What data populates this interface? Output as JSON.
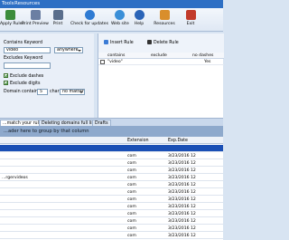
{
  "menu": {
    "items": [
      "Tools",
      "Resources"
    ]
  },
  "toolbar": {
    "buttons": [
      {
        "label": "Apply Rules",
        "icon": "apply-rules-icon",
        "color": "#3c8d3c"
      },
      {
        "label": "Print Preview",
        "icon": "print-preview-icon",
        "color": "#6b7fa3"
      },
      {
        "label": "Print",
        "icon": "printer-icon",
        "color": "#5a6e8c"
      },
      {
        "label": "Check for updates",
        "icon": "update-icon",
        "color": "#2f7bd3"
      },
      {
        "label": "Web site",
        "icon": "globe-icon",
        "color": "#3a8fd8"
      },
      {
        "label": "Help",
        "icon": "help-icon",
        "color": "#2a64b8"
      },
      {
        "label": "Resources",
        "icon": "resources-icon",
        "color": "#d98e2b"
      },
      {
        "label": "Exit",
        "icon": "exit-icon",
        "color": "#c23b2b"
      }
    ]
  },
  "left": {
    "contains_label": "Contains Keyword",
    "contains_value": "video",
    "match_value": "anywhere",
    "excludes_label": "Excludes Keyword",
    "excludes_value": "",
    "exclude_dashes": "Exclude dashes",
    "exclude_digits": "Exclude digits",
    "domain_contains_label": "Domain contains",
    "domain_contains_value": "5",
    "char_label": "char",
    "no_matter_value": "no matter"
  },
  "right": {
    "insert_rule": "Insert Rule",
    "delete_rule": "Delete Rule",
    "headers": [
      "contains",
      "exclude",
      "no dashes"
    ],
    "rows": [
      {
        "contains": "\"video\"",
        "exclude": "",
        "no_dashes": "Yes"
      }
    ]
  },
  "tabs": [
    "...match your rules",
    "Deleting domains full list",
    "Drafts"
  ],
  "group_hint": "...ader here to group by that column",
  "grid": {
    "headers": [
      "Extension",
      "Exp.Date"
    ],
    "rows": [
      {
        "name": "",
        "ext": "",
        "date": "",
        "selected": true
      },
      {
        "name": "",
        "ext": "com",
        "date": "3/23/2016 12",
        "selected": false
      },
      {
        "name": "",
        "ext": "com",
        "date": "3/23/2016 12",
        "selected": false
      },
      {
        "name": "",
        "ext": "com",
        "date": "3/23/2016 12",
        "selected": false
      },
      {
        "name": "...rgervideos",
        "ext": "com",
        "date": "3/23/2016 12",
        "selected": false
      },
      {
        "name": "",
        "ext": "com",
        "date": "3/23/2016 12",
        "selected": false
      },
      {
        "name": "",
        "ext": "com",
        "date": "3/23/2016 12",
        "selected": false
      },
      {
        "name": "",
        "ext": "com",
        "date": "3/23/2016 12",
        "selected": false
      },
      {
        "name": "",
        "ext": "com",
        "date": "3/23/2016 12",
        "selected": false
      },
      {
        "name": "",
        "ext": "com",
        "date": "3/23/2016 12",
        "selected": false
      },
      {
        "name": "",
        "ext": "com",
        "date": "3/23/2016 12",
        "selected": false
      },
      {
        "name": "",
        "ext": "com",
        "date": "3/23/2016 12",
        "selected": false
      },
      {
        "name": "",
        "ext": "com",
        "date": "3/23/2016 12",
        "selected": false
      }
    ]
  }
}
